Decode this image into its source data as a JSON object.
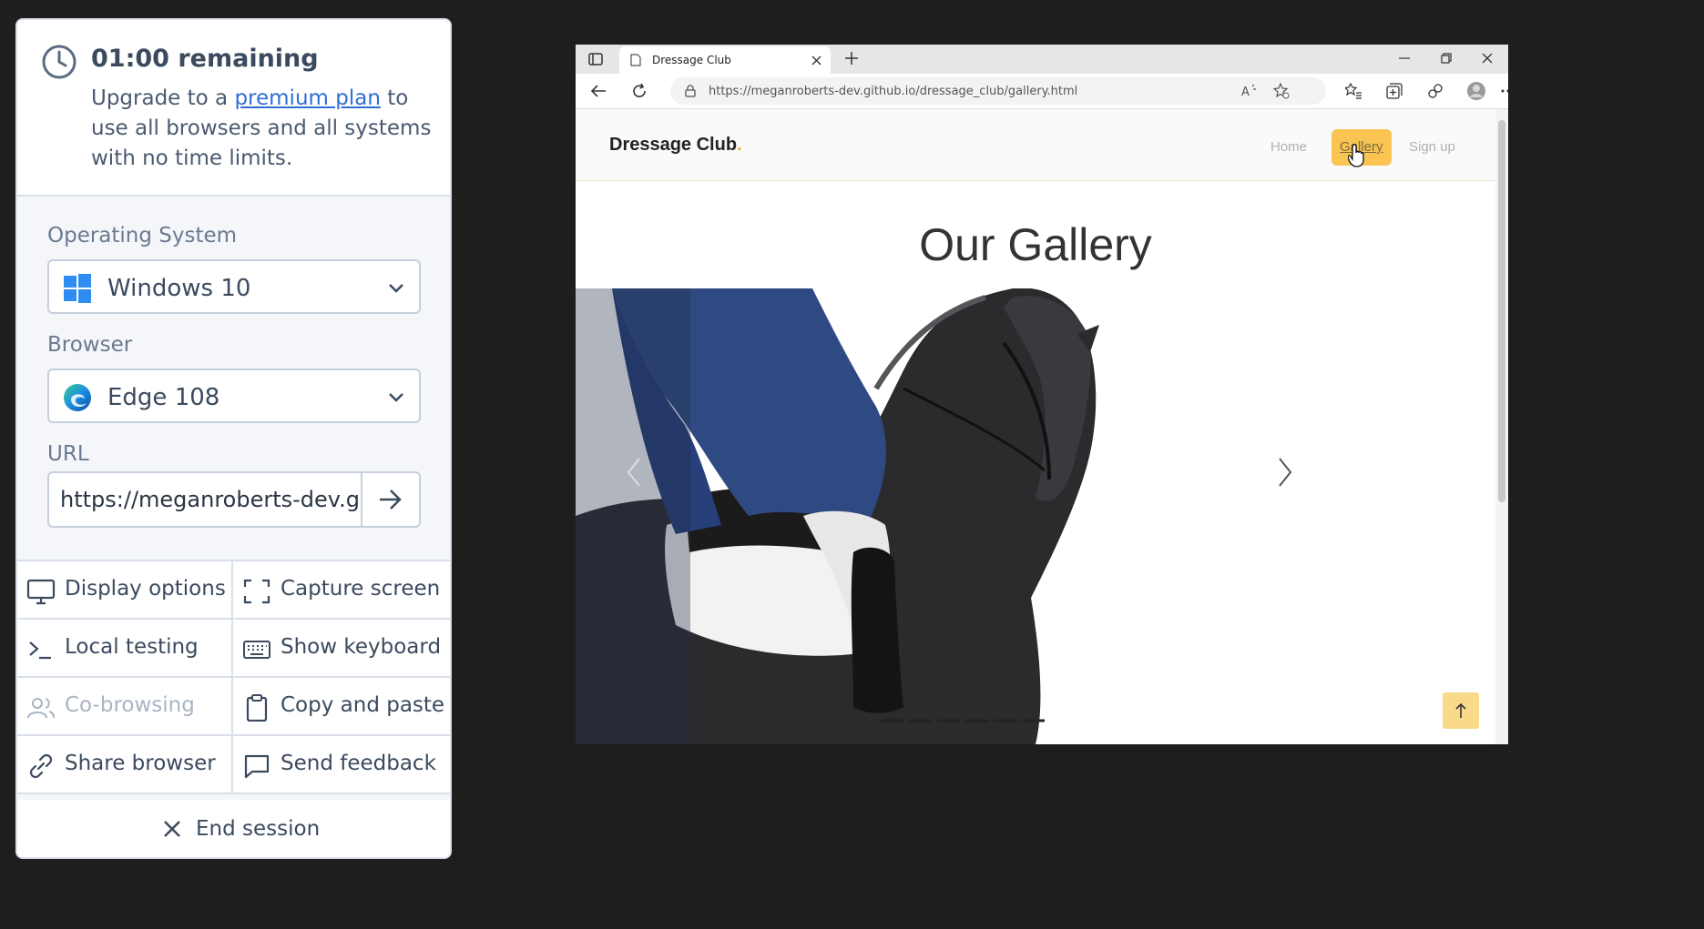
{
  "panel": {
    "timer_title": "01:00 remaining",
    "upgrade_prefix": "Upgrade to a ",
    "upgrade_link": "premium plan",
    "upgrade_suffix": " to use all browsers and all systems with no time limits.",
    "os_label": "Operating System",
    "os_value": "Windows 10",
    "browser_label": "Browser",
    "browser_value": "Edge 108",
    "url_label": "URL",
    "url_value": "https://meganroberts-dev.github.io/dressage_club/gallery.html",
    "actions": [
      {
        "label": "Display options",
        "icon": "monitor-icon",
        "enabled": true
      },
      {
        "label": "Capture screen",
        "icon": "capture-icon",
        "enabled": true
      },
      {
        "label": "Local testing",
        "icon": "terminal-icon",
        "enabled": true
      },
      {
        "label": "Show keyboard",
        "icon": "keyboard-icon",
        "enabled": true
      },
      {
        "label": "Co-browsing",
        "icon": "users-icon",
        "enabled": false
      },
      {
        "label": "Copy and paste",
        "icon": "clipboard-icon",
        "enabled": true
      },
      {
        "label": "Share browser",
        "icon": "link-icon",
        "enabled": true
      },
      {
        "label": "Send feedback",
        "icon": "feedback-icon",
        "enabled": true
      }
    ],
    "end_session": "End session",
    "colors": {
      "link": "#2f6fd6",
      "text": "#3b4a5e",
      "border": "#d9e0ea"
    }
  },
  "browser": {
    "tab_title": "Dressage Club",
    "url_host": "https://meganroberts-dev.github.io",
    "url_path": "/dressage_club/gallery.html"
  },
  "site": {
    "brand": "Dressage Club",
    "brand_dot": ".",
    "nav": [
      "Home",
      "Gallery",
      "Sign up"
    ],
    "active_nav": "Gallery",
    "heading": "Our Gallery",
    "colors": {
      "accent": "#f9c451"
    }
  }
}
